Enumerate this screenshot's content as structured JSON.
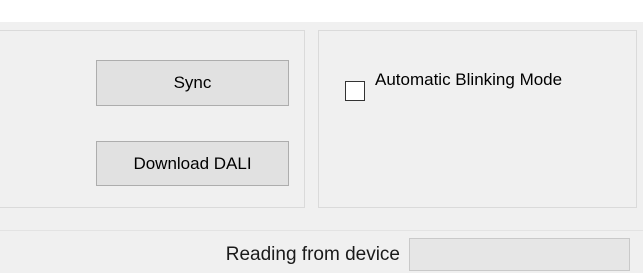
{
  "buttons": {
    "sync_label": "Sync",
    "download_label": "Download DALI"
  },
  "options": {
    "auto_blinking_label": "Automatic Blinking Mode",
    "auto_blinking_checked": false
  },
  "status": {
    "label": "Reading from device",
    "value": ""
  },
  "colors": {
    "background": "#f0f0f0",
    "button_face": "#e1e1e1",
    "button_border": "#adadad",
    "field_background": "#e6e6e6"
  }
}
